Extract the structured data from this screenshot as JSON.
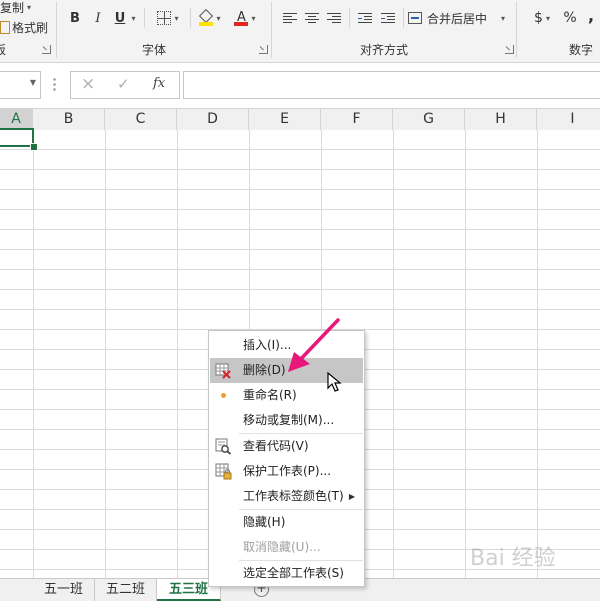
{
  "ribbon": {
    "clipboard": {
      "copy_label": "复制",
      "format_painter_label": "格式刷",
      "group_label_partial": "板"
    },
    "font": {
      "group_label": "字体",
      "bold": "B",
      "italic": "I",
      "underline": "U",
      "font_color_letter": "A",
      "fill_color": "#ffe100",
      "font_color": "#e0281f"
    },
    "alignment": {
      "group_label": "对齐方式",
      "merge_center_label": "合并后居中"
    },
    "number": {
      "group_label_partial": "数字",
      "currency": "$",
      "percent": "%",
      "comma": ","
    }
  },
  "formula_bar": {
    "name_box_value": "",
    "cancel_icon": "×",
    "enter_icon": "✓",
    "fx_label": "fx",
    "formula_value": ""
  },
  "columns": [
    "A",
    "B",
    "C",
    "D",
    "E",
    "F",
    "G",
    "H",
    "I"
  ],
  "active_column": "A",
  "sheet_tabs": [
    "五一班",
    "五二班",
    "五三班"
  ],
  "active_sheet": "五三班",
  "add_sheet_label": "+",
  "context_menu": {
    "items": [
      {
        "label": "插入(I)...",
        "icon": "",
        "enabled": true
      },
      {
        "label": "删除(D)",
        "icon": "delete-sheet-icon",
        "enabled": true,
        "hover": true
      },
      {
        "label": "重命名(R)",
        "icon": "dot-icon",
        "enabled": true
      },
      {
        "label": "移动或复制(M)...",
        "icon": "",
        "enabled": true
      },
      {
        "label": "查看代码(V)",
        "icon": "view-code-icon",
        "enabled": true
      },
      {
        "label": "保护工作表(P)...",
        "icon": "protect-sheet-icon",
        "enabled": true
      },
      {
        "label": "工作表标签颜色(T)",
        "icon": "",
        "enabled": true,
        "submenu": true
      },
      {
        "label": "隐藏(H)",
        "icon": "",
        "enabled": true
      },
      {
        "label": "取消隐藏(U)...",
        "icon": "",
        "enabled": false
      },
      {
        "label": "选定全部工作表(S)",
        "icon": "",
        "enabled": true
      }
    ]
  },
  "watermark": "Bai 经验",
  "accent_color": "#217346",
  "annotation_arrow_color": "#e8187a"
}
